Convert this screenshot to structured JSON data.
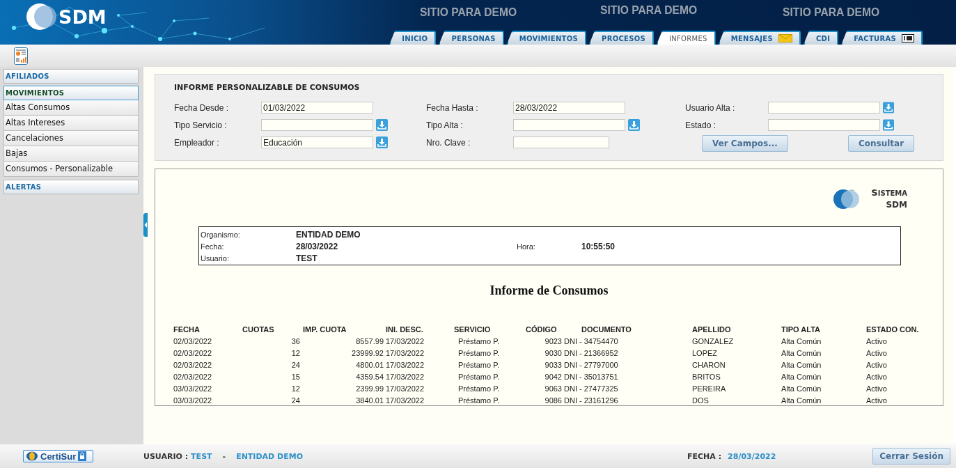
{
  "header": {
    "logo": "SDM",
    "banners": [
      "SITIO PARA DEMO",
      "SITIO PARA DEMO",
      "SITIO PARA DEMO"
    ]
  },
  "tabs": [
    {
      "label": "INICIO",
      "selected": false
    },
    {
      "label": "PERSONAS",
      "selected": false
    },
    {
      "label": "MOVIMIENTOS",
      "selected": false
    },
    {
      "label": "PROCESOS",
      "selected": false
    },
    {
      "label": "INFORMES",
      "selected": true
    },
    {
      "label": "MENSAJES",
      "selected": false,
      "kind": "mail"
    },
    {
      "label": "CDI",
      "selected": false
    },
    {
      "label": "FACTURAS",
      "selected": false,
      "kind": "bill"
    }
  ],
  "sidebar": {
    "sections": [
      {
        "label": "AFILIADOS",
        "expanded": false
      },
      {
        "label": "MOVIMIENTOS",
        "expanded": true,
        "children": [
          {
            "label": "Altas Consumos"
          },
          {
            "label": "Altas Intereses"
          },
          {
            "label": "Cancelaciones"
          },
          {
            "label": "Bajas"
          },
          {
            "label": "Consumos - Personalizable"
          }
        ]
      },
      {
        "label": "ALERTAS",
        "expanded": false
      }
    ]
  },
  "filters": {
    "title": "INFORME PERSONALIZABLE DE CONSUMOS",
    "fields": [
      {
        "label": "Fecha Desde :",
        "value": "01/03/2022",
        "kind": "text"
      },
      {
        "label": "Fecha Hasta :",
        "value": "28/03/2022",
        "kind": "text"
      },
      {
        "label": "Usuario Alta :",
        "kind": "lookup"
      },
      {
        "label": "Tipo Servicio :",
        "kind": "lookup"
      },
      {
        "label": "Tipo Alta :",
        "kind": "lookup"
      },
      {
        "label": "Estado :",
        "kind": "lookup"
      },
      {
        "label": "Empleador :",
        "value": "Educación",
        "kind": "lookup"
      },
      {
        "label": "Nro. Clave :",
        "kind": "short"
      }
    ],
    "buttons": [
      "Ver Campos...",
      "Consultar"
    ]
  },
  "report": {
    "logo": [
      "SISTEMA",
      "SDM"
    ],
    "info": [
      {
        "label": "Organismo:",
        "value": "ENTIDAD DEMO"
      },
      {
        "label": "Fecha:",
        "value": "28/03/2022",
        "label2": "Hora:",
        "value2": "10:55:50"
      },
      {
        "label": "Usuario:",
        "value": "TEST"
      }
    ],
    "title": "Informe de Consumos",
    "table": {
      "columns": [
        "FECHA",
        "CUOTAS",
        "IMP. CUOTA",
        "INI. DESC.",
        "SERVICIO",
        "CÓDIGO",
        "DOCUMENTO",
        "APELLIDO",
        "TIPO ALTA",
        "ESTADO CON."
      ],
      "rows": [
        [
          "02/03/2022",
          "36",
          "8557.99",
          "17/03/2022",
          "Préstamo P.",
          "9023",
          "DNI - 34754470",
          "GONZALEZ",
          "Alta Común",
          "Activo"
        ],
        [
          "02/03/2022",
          "12",
          "23999.92",
          "17/03/2022",
          "Préstamo P.",
          "9030",
          "DNI - 21366952",
          "LOPEZ",
          "Alta Común",
          "Activo"
        ],
        [
          "02/03/2022",
          "24",
          "4800.01",
          "17/03/2022",
          "Préstamo P.",
          "9033",
          "DNI - 27797000",
          "CHARON",
          "Alta Común",
          "Activo"
        ],
        [
          "02/03/2022",
          "15",
          "4359.54",
          "17/03/2022",
          "Préstamo P.",
          "9042",
          "DNI - 35013751",
          "BRITOS",
          "Alta Común",
          "Activo"
        ],
        [
          "03/03/2022",
          "12",
          "2399.99",
          "17/03/2022",
          "Préstamo P.",
          "9063",
          "DNI - 27477325",
          "PEREIRA",
          "Alta Común",
          "Activo"
        ],
        [
          "03/03/2022",
          "24",
          "3840.01",
          "17/03/2022",
          "Préstamo P.",
          "9086",
          "DNI - 23161296",
          "DOS",
          "Alta Común",
          "Activo"
        ]
      ]
    }
  },
  "footer": {
    "brand": "CertiSur",
    "user_label": "USUARIO :",
    "user": "TEST",
    "separator": "-",
    "entity": "ENTIDAD DEMO",
    "date_label": "FECHA :",
    "date": "28/03/2022",
    "logout": "Cerrar Sesión"
  }
}
